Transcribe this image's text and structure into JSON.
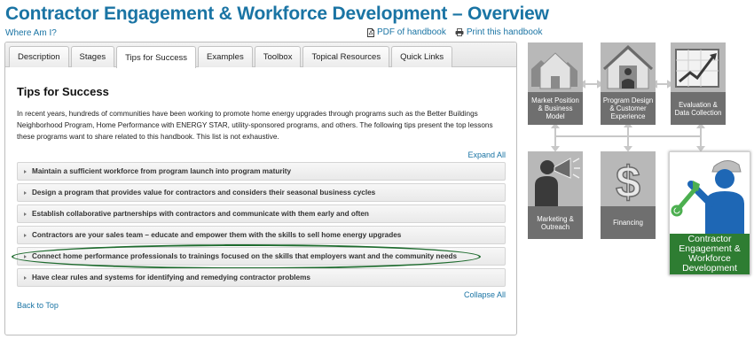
{
  "page": {
    "title": "Contractor Engagement & Workforce Development – Overview",
    "where_am_i": "Where Am I?",
    "pdf_link": "PDF of handbook",
    "print_link": "Print this handbook"
  },
  "tabs": [
    "Description",
    "Stages",
    "Tips for Success",
    "Examples",
    "Toolbox",
    "Topical Resources",
    "Quick Links"
  ],
  "active_tab": "Tips for Success",
  "content": {
    "heading": "Tips for Success",
    "intro": "In recent years, hundreds of communities have been working to promote home energy upgrades through programs such as the Better Buildings Neighborhood Program, Home Performance with ENERGY STAR, utility-sponsored programs, and others. The following tips present the top lessons these programs want to share related to this handbook. This list is not exhaustive.",
    "expand_all": "Expand All",
    "collapse_all": "Collapse All",
    "back_to_top": "Back to Top",
    "tips": [
      "Maintain a sufficient workforce from program launch into program maturity",
      "Design a program that provides value for contractors and considers their seasonal business cycles",
      "Establish collaborative partnerships with contractors and communicate with them early and often",
      "Contractors are your sales team – educate and empower them with the skills to sell home energy upgrades",
      "Connect home performance professionals to trainings focused on the skills that employers want and the community needs",
      "Have clear rules and systems for identifying and remedying contractor problems"
    ],
    "highlighted_tip_index": 4
  },
  "diagram": {
    "nodes": [
      {
        "label": "Market Position & Business Model",
        "icon": "house-neighborhood-icon"
      },
      {
        "label": "Program Design & Customer Experience",
        "icon": "house-person-icon"
      },
      {
        "label": "Evaluation & Data Collection",
        "icon": "growth-chart-icon"
      },
      {
        "label": "Marketing & Outreach",
        "icon": "megaphone-person-icon"
      },
      {
        "label": "Financing",
        "icon": "dollar-sign-icon"
      },
      {
        "label": "Contractor Engagement & Workforce Development",
        "icon": "worker-wrench-icon"
      }
    ],
    "active_node": "Contractor Engagement & Workforce Development",
    "colors": {
      "inactive_pic": "#b8b8b8",
      "inactive_caption": "#6f6f6f",
      "active_caption": "#2e7d32",
      "connector": "#c8c8c8",
      "worker_blue": "#1e67b5"
    }
  },
  "colors": {
    "link": "#1a74a4",
    "highlight_ring": "#1e6b2e"
  }
}
